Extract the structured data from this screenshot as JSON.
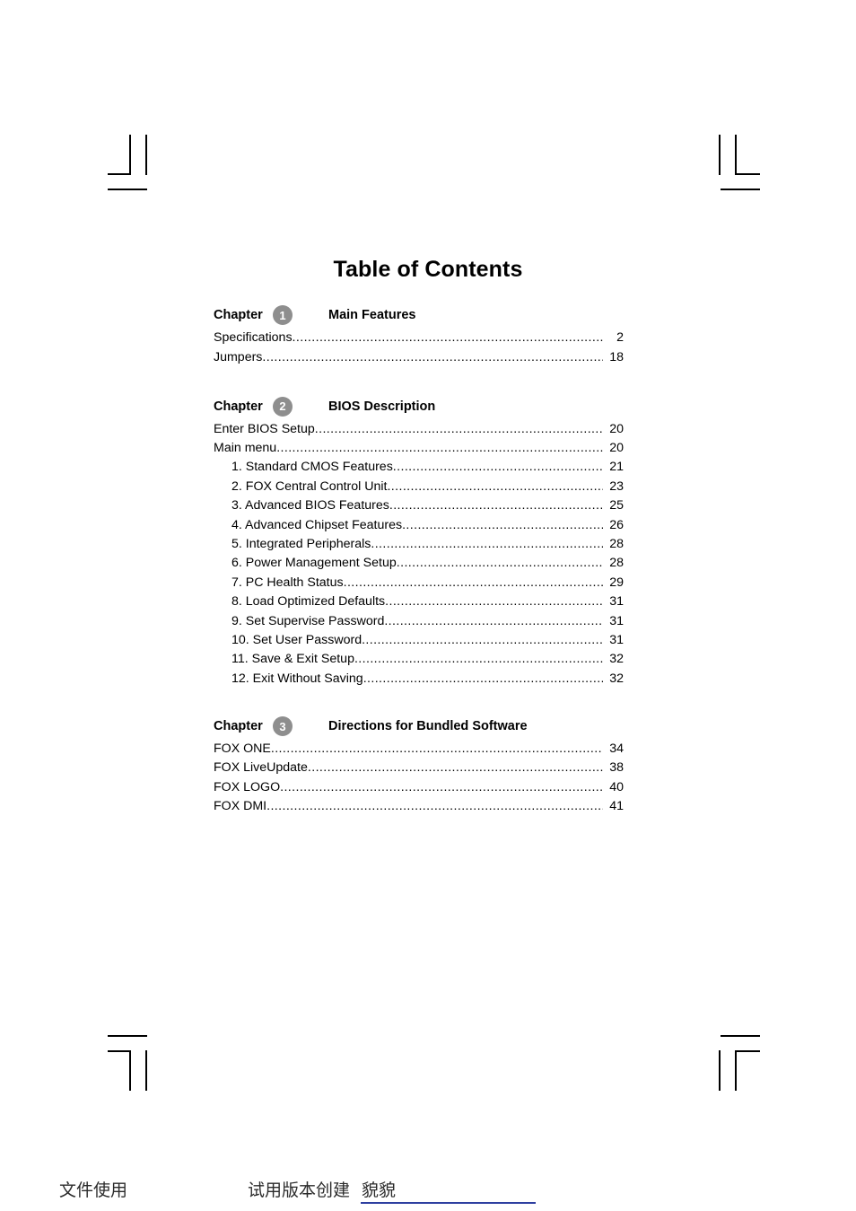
{
  "document": {
    "title": "Table of Contents"
  },
  "chapters": [
    {
      "label": "Chapter",
      "number": "1",
      "name": "Main Features",
      "entries": [
        {
          "label": "Specifications",
          "page": "2",
          "indent": false
        },
        {
          "label": "Jumpers",
          "page": "18",
          "indent": false
        }
      ]
    },
    {
      "label": "Chapter",
      "number": "2",
      "name": "BIOS Description",
      "entries": [
        {
          "label": "Enter BIOS Setup",
          "page": "20",
          "indent": false
        },
        {
          "label": "Main menu",
          "page": "20",
          "indent": false
        },
        {
          "label": "1. Standard CMOS Features",
          "page": "21",
          "indent": true
        },
        {
          "label": "2. FOX Central Control Unit",
          "page": "23",
          "indent": true
        },
        {
          "label": "3.  Advanced BIOS Features",
          "page": "25",
          "indent": true
        },
        {
          "label": "4. Advanced Chipset Features",
          "page": "26",
          "indent": true
        },
        {
          "label": "5. Integrated Peripherals",
          "page": "28",
          "indent": true
        },
        {
          "label": "6. Power Management Setup",
          "page": "28",
          "indent": true
        },
        {
          "label": "7. PC Health Status",
          "page": "29",
          "indent": true
        },
        {
          "label": "8. Load Optimized Defaults",
          "page": "31",
          "indent": true
        },
        {
          "label": "9. Set Supervise Password",
          "page": "31",
          "indent": true
        },
        {
          "label": "10. Set User Password",
          "page": "31",
          "indent": true
        },
        {
          "label": "11. Save & Exit Setup",
          "page": "32",
          "indent": true
        },
        {
          "label": "12. Exit Without Saving",
          "page": "32",
          "indent": true
        }
      ]
    },
    {
      "label": "Chapter",
      "number": "3",
      "name": "Directions for Bundled Software",
      "entries": [
        {
          "label": "FOX ONE",
          "page": "34",
          "indent": false
        },
        {
          "label": "FOX LiveUpdate",
          "page": "38",
          "indent": false
        },
        {
          "label": "FOX LOGO",
          "page": "40",
          "indent": false
        },
        {
          "label": "FOX DMI",
          "page": "41",
          "indent": false
        }
      ]
    }
  ],
  "footer": {
    "left_text": "文件使用",
    "middle_text": "试用版本创建",
    "signature": "貌貌",
    "rule_color": "#2e3fa0"
  },
  "marks": {
    "badge_color": "#8e8e8e",
    "crop_mark_color": "#000000"
  }
}
